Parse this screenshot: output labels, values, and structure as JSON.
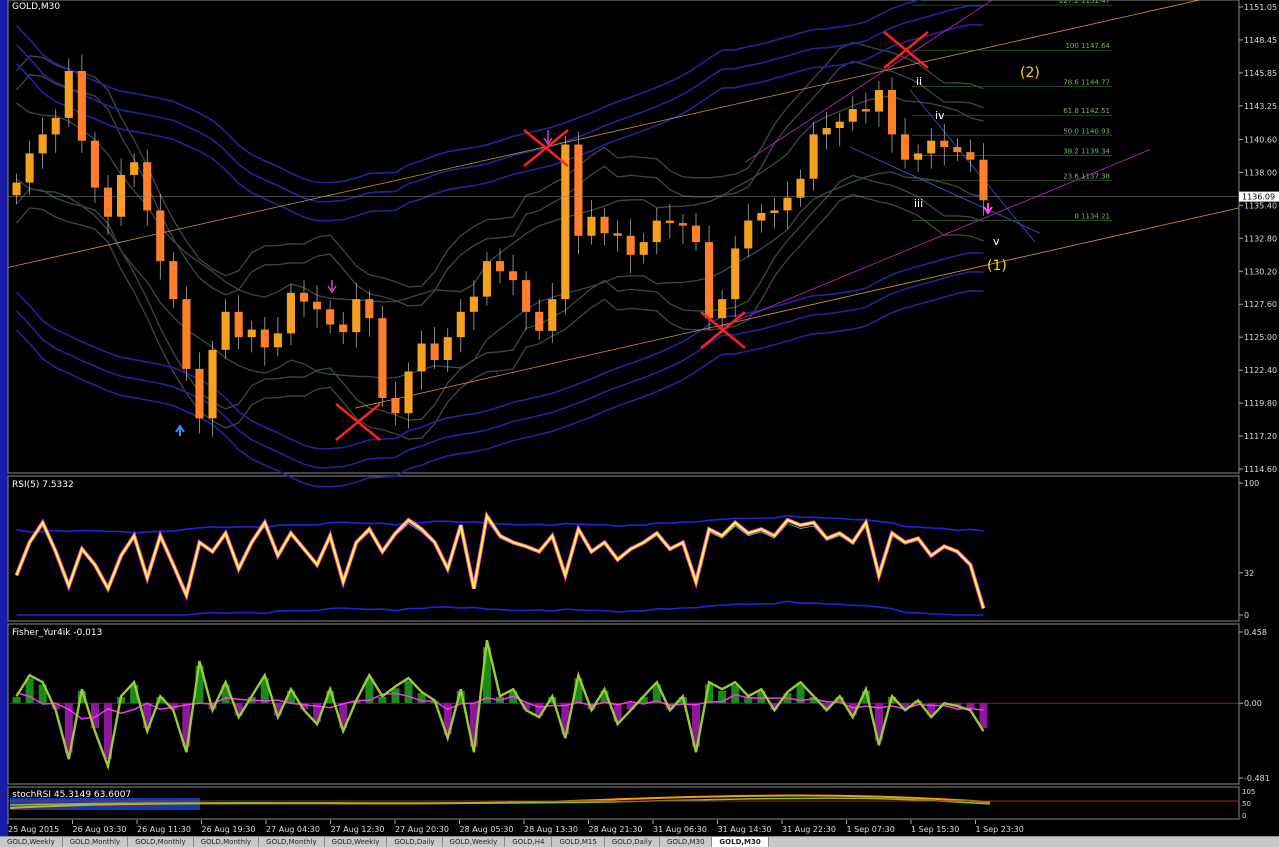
{
  "window": {
    "title": "GOLD,M30"
  },
  "main_chart": {
    "symbol_label": "GOLD,M30",
    "current_price": "1136.09",
    "y_ticks": [
      "1151.05",
      "1148.45",
      "1145.85",
      "1143.25",
      "1140.60",
      "1138.00",
      "1135.40",
      "1132.80",
      "1130.20",
      "1127.60",
      "1125.00",
      "1122.40",
      "1119.80",
      "1117.20",
      "1114.60"
    ],
    "x_ticks": [
      "25 Aug 2015",
      "26 Aug 03:30",
      "26 Aug 11:30",
      "26 Aug 19:30",
      "27 Aug 04:30",
      "27 Aug 12:30",
      "27 Aug 20:30",
      "28 Aug 05:30",
      "28 Aug 13:30",
      "28 Aug 21:30",
      "31 Aug 06:30",
      "31 Aug 14:30",
      "31 Aug 22:30",
      "1 Sep 07:30",
      "1 Sep 15:30",
      "1 Sep 23:30"
    ],
    "fib_levels": [
      {
        "label": "100 1147.64",
        "price": 1147.64
      },
      {
        "label": "78.6 1144.77",
        "price": 1144.77
      },
      {
        "label": "61.8 1142.51",
        "price": 1142.51
      },
      {
        "label": "50.0 1140.93",
        "price": 1140.93
      },
      {
        "label": "38.2 1139.34",
        "price": 1139.34
      },
      {
        "label": "23.6 1137.38",
        "price": 1137.38
      },
      {
        "label": "0 1134.21",
        "price": 1134.21
      }
    ],
    "fib_top_label": "127.2 1151.47",
    "wave_labels": {
      "ii": "ii",
      "iii": "iii",
      "iv": "iv",
      "v": "v",
      "w1": "(1)",
      "w2": "(2)"
    },
    "close_series": [
      1137.2,
      1139.5,
      1141.0,
      1142.3,
      1146.0,
      1140.5,
      1136.8,
      1134.5,
      1137.8,
      1138.8,
      1135.0,
      1131.0,
      1128.0,
      1122.5,
      1118.6,
      1124.0,
      1127.0,
      1125.0,
      1125.6,
      1124.2,
      1125.3,
      1128.5,
      1127.8,
      1127.2,
      1126.0,
      1125.4,
      1128.0,
      1126.5,
      1120.2,
      1119.0,
      1122.3,
      1124.5,
      1123.2,
      1125.0,
      1127.0,
      1128.2,
      1131.0,
      1130.2,
      1129.5,
      1127.0,
      1125.5,
      1128.0,
      1140.2,
      1133.0,
      1134.5,
      1133.2,
      1133.0,
      1131.5,
      1132.5,
      1134.2,
      1134.0,
      1133.8,
      1132.5,
      1126.5,
      1128.0,
      1132.0,
      1134.2,
      1134.8,
      1135.0,
      1136.0,
      1137.5,
      1141.0,
      1141.5,
      1142.0,
      1143.0,
      1142.8,
      1144.5,
      1141.0,
      1139.0,
      1139.5,
      1140.5,
      1140.0,
      1139.6,
      1139.0,
      1135.8
    ]
  },
  "rsi_panel": {
    "label": "RSI(5) 7.5332",
    "y_ticks": [
      "100",
      "32",
      "0"
    ],
    "values": [
      30,
      55,
      70,
      48,
      22,
      50,
      38,
      20,
      45,
      60,
      28,
      60,
      38,
      15,
      55,
      48,
      62,
      35,
      55,
      70,
      45,
      62,
      50,
      38,
      60,
      25,
      55,
      65,
      48,
      62,
      72,
      65,
      55,
      35,
      68,
      20,
      75,
      60,
      55,
      52,
      48,
      60,
      30,
      65,
      48,
      55,
      42,
      50,
      55,
      62,
      50,
      55,
      25,
      65,
      60,
      70,
      62,
      65,
      60,
      72,
      68,
      70,
      58,
      62,
      55,
      70,
      30,
      62,
      55,
      58,
      45,
      52,
      48,
      38,
      5
    ]
  },
  "fisher_panel": {
    "label": "Fisher_Yur4ik -0.013",
    "y_ticks": [
      "0.458",
      "0.00",
      "-0.481"
    ],
    "values": [
      0.05,
      0.2,
      0.15,
      -0.05,
      -0.4,
      0.1,
      -0.2,
      -0.45,
      0.05,
      0.15,
      -0.2,
      0.05,
      -0.05,
      -0.35,
      0.3,
      -0.05,
      0.15,
      -0.1,
      0.05,
      0.2,
      -0.1,
      0.1,
      -0.05,
      -0.15,
      0.1,
      -0.2,
      0.02,
      0.2,
      0.05,
      0.12,
      0.18,
      0.08,
      0.02,
      -0.25,
      0.1,
      -0.35,
      0.45,
      0.05,
      0.1,
      -0.05,
      -0.1,
      0.05,
      -0.25,
      0.2,
      -0.05,
      0.1,
      -0.15,
      -0.05,
      0.05,
      0.15,
      -0.05,
      0.05,
      -0.35,
      0.15,
      0.1,
      0.15,
      0.05,
      0.1,
      -0.05,
      0.08,
      0.15,
      0.05,
      -0.05,
      0.05,
      -0.1,
      0.1,
      -0.3,
      0.05,
      -0.05,
      0.02,
      -0.1,
      0.0,
      -0.02,
      -0.05,
      -0.2
    ]
  },
  "stoch_panel": {
    "label": "stochRSI 45.3149 63.6007",
    "y_ticks": [
      "105",
      "50",
      "0"
    ]
  },
  "tabs": [
    "GOLD,Weekly",
    "GOLD,Monthly",
    "GOLD,Monthly",
    "GOLD,Monthly",
    "GOLD,Monthly",
    "GOLD,Weekly",
    "GOLD,Daily",
    "GOLD,Weekly",
    "GOLD,H4",
    "GOLD,M15",
    "GOLD,Daily",
    "GOLD,M30",
    "GOLD,M30"
  ],
  "active_tab_index": 12,
  "colors": {
    "bull_candle": "#f5a020",
    "bear_candle": "#ff7f2a",
    "wick": "#c0c0c0",
    "blue_band": "#2323a0",
    "gray_band": "#3a4a4a",
    "orange_line": "#d89a2a",
    "magenta_line": "#cc22cc",
    "fib_line": "#2e5f2e",
    "fib_text": "#6fb36f",
    "rsi_main": "#ffff22",
    "rsi_glow": "#ff33ff",
    "fisher_hist_pos": "#1a8a1a",
    "fisher_hist_neg": "#8a1a9a",
    "fisher_line": "#9acd32",
    "fisher_signal": "#ff33ff"
  }
}
